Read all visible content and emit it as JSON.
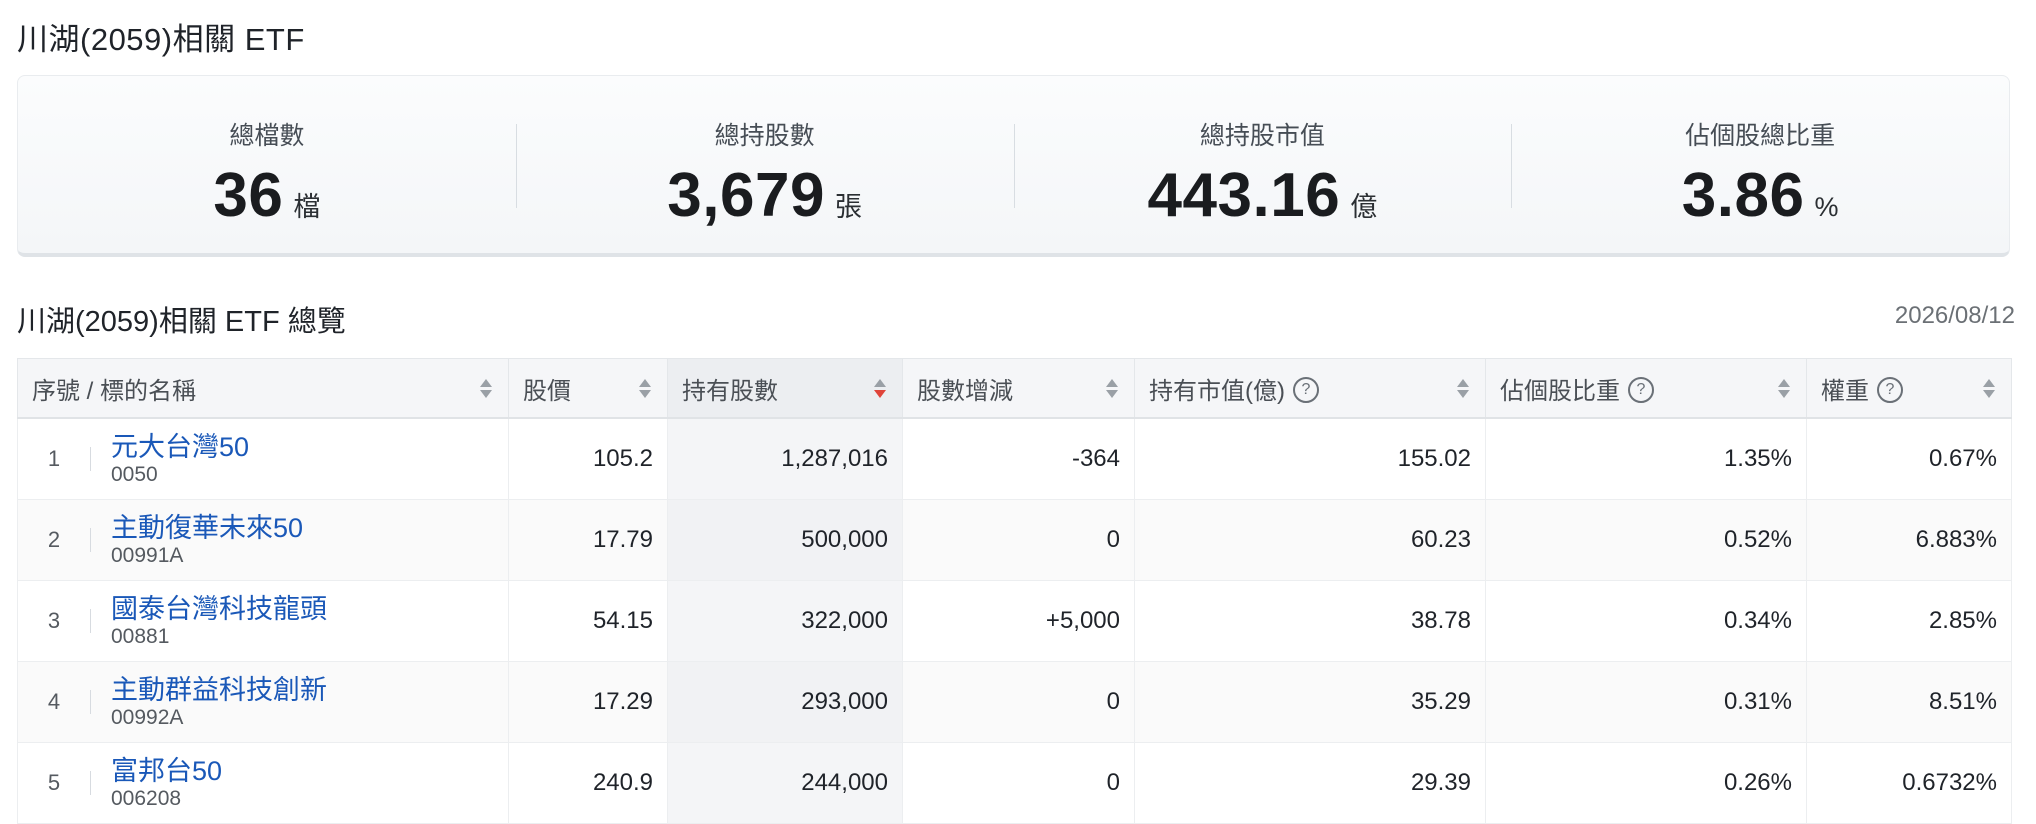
{
  "page_title": "川湖(2059)相關 ETF",
  "summary": [
    {
      "label": "總檔數",
      "value": "36",
      "unit": "檔"
    },
    {
      "label": "總持股數",
      "value": "3,679",
      "unit": "張"
    },
    {
      "label": "總持股市值",
      "value": "443.16",
      "unit": "億"
    },
    {
      "label": "佔個股總比重",
      "value": "3.86",
      "unit": "%"
    }
  ],
  "overview": {
    "title": "川湖(2059)相關 ETF 總覽",
    "date": "2026/08/12"
  },
  "table": {
    "headers": [
      "序號 / 標的名稱",
      "股價",
      "持有股數",
      "股數增減",
      "持有市值(億)",
      "佔個股比重",
      "權重"
    ],
    "help_glyph": "?",
    "rows": [
      {
        "idx": "1",
        "name": "元大台灣50",
        "code": "0050",
        "price": "105.2",
        "shares": "1,287,016",
        "change": "-364",
        "value": "155.02",
        "ratio": "1.35%",
        "weight": "0.67%"
      },
      {
        "idx": "2",
        "name": "主動復華未來50",
        "code": "00991A",
        "price": "17.79",
        "shares": "500,000",
        "change": "0",
        "value": "60.23",
        "ratio": "0.52%",
        "weight": "6.883%"
      },
      {
        "idx": "3",
        "name": "國泰台灣科技龍頭",
        "code": "00881",
        "price": "54.15",
        "shares": "322,000",
        "change": "+5,000",
        "value": "38.78",
        "ratio": "0.34%",
        "weight": "2.85%"
      },
      {
        "idx": "4",
        "name": "主動群益科技創新",
        "code": "00992A",
        "price": "17.29",
        "shares": "293,000",
        "change": "0",
        "value": "35.29",
        "ratio": "0.31%",
        "weight": "8.51%"
      },
      {
        "idx": "5",
        "name": "富邦台50",
        "code": "006208",
        "price": "240.9",
        "shares": "244,000",
        "change": "0",
        "value": "29.39",
        "ratio": "0.26%",
        "weight": "0.6732%"
      }
    ]
  },
  "colors": {
    "link": "#1a58b8",
    "sort_active": "#e0443a",
    "sort_idle": "#9aa0a6"
  },
  "icons": {
    "sort": "sort-arrows-icon",
    "help": "help-circle-icon"
  }
}
